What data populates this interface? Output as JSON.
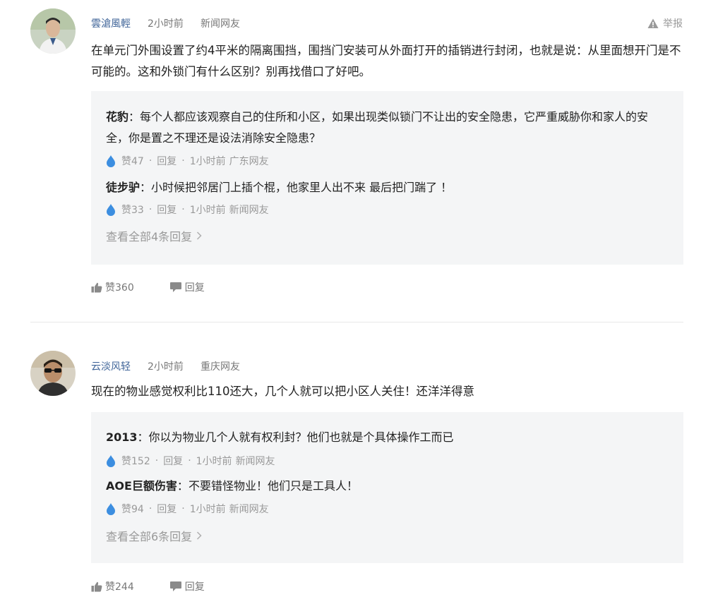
{
  "colors": {
    "username": "#406599",
    "meta": "#777777",
    "reply_bg": "#f4f5f6",
    "like_drop": "#3c8ee0"
  },
  "comments": [
    {
      "username": "雲滄風輕",
      "time": "2小时前",
      "location": "新闻网友",
      "report_label": "举报",
      "text": "在单元门外围设置了约4平米的隔离围挡，围挡门安装可从外面打开的插销进行封闭，也就是说：从里面想开门是不可能的。这和外锁门有什么区别？别再找借口了好吧。",
      "replies": [
        {
          "name": "花豹",
          "sep": "：",
          "text": "每个人都应该观察自己的住所和小区，如果出现类似锁门不让出的安全隐患，它严重威胁你和家人的安全，你是置之不理还是设法消除安全隐患？",
          "likes": "赞47",
          "reply_label": "回复",
          "time": "1小时前",
          "location": "广东网友"
        },
        {
          "name": "徒步驴",
          "sep": "：",
          "text": "小时候把邻居门上插个棍，他家里人出不来 最后把门踹了 ！",
          "likes": "赞33",
          "reply_label": "回复",
          "time": "1小时前",
          "location": "新闻网友"
        }
      ],
      "view_all": "查看全部4条回复",
      "like_label": "赞360",
      "reply_label": "回复"
    },
    {
      "username": "云淡风轻",
      "time": "2小时前",
      "location": "重庆网友",
      "text": "现在的物业感觉权利比110还大，几个人就可以把小区人关住！还洋洋得意",
      "replies": [
        {
          "name": "2013",
          "sep": "：",
          "text": "你以为物业几个人就有权利封？他们也就是个具体操作工而已",
          "likes": "赞152",
          "reply_label": "回复",
          "time": "1小时前",
          "location": "新闻网友"
        },
        {
          "name": "AOE巨额伤害",
          "sep": "：",
          "text": "不要错怪物业！他们只是工具人！",
          "likes": "赞94",
          "reply_label": "回复",
          "time": "1小时前",
          "location": "新闻网友"
        }
      ],
      "view_all": "查看全部6条回复",
      "like_label": "赞244",
      "reply_label": "回复"
    }
  ]
}
